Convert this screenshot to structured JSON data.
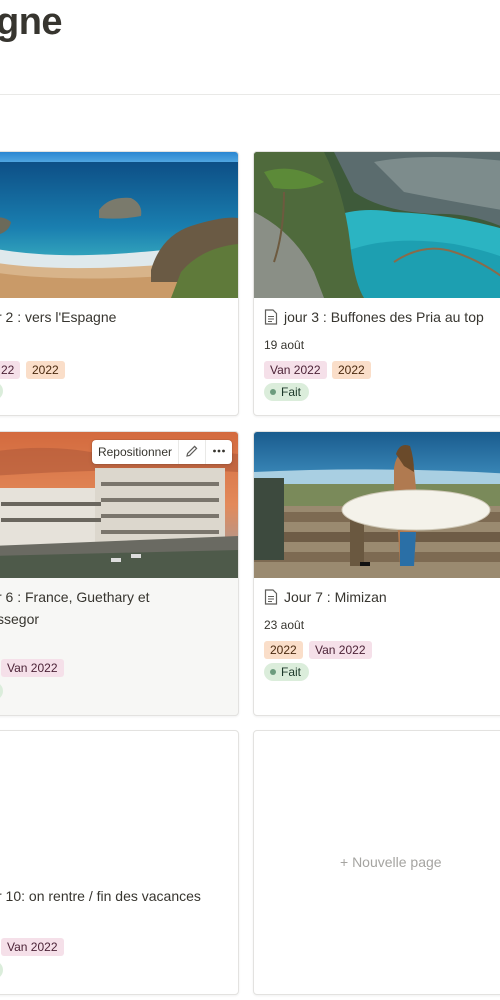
{
  "page": {
    "title": "gne"
  },
  "cards": [
    {
      "title": "r 2 : vers l'Espagne",
      "date": "",
      "tags": [
        "22",
        "2022"
      ],
      "status": ""
    },
    {
      "title": "jour 3 : Buffones des Pria au top",
      "date": "19 août",
      "tags": [
        "Van 2022",
        "2022"
      ],
      "status": "Fait"
    },
    {
      "title_line1": "r 6 : France, Guethary et",
      "title_line2": "ssegor",
      "tags": [
        "Van 2022"
      ],
      "status": "",
      "cover_tools": {
        "reposition": "Repositionner",
        "edit_icon": "pencil-icon",
        "more_icon": "more-icon"
      }
    },
    {
      "title": "Jour 7 : Mimizan",
      "date": "23 août",
      "tags": [
        "2022",
        "Van 2022"
      ],
      "status": "Fait"
    },
    {
      "title": "r 10: on rentre / fin des vacances",
      "tags": [
        "Van 2022"
      ],
      "status": ""
    }
  ],
  "new_page": {
    "label": "+ Nouvelle page"
  },
  "colors": {
    "tag_van": "#f5e0e9",
    "tag_year": "#fadec9",
    "status_done": "#dbeddb"
  }
}
